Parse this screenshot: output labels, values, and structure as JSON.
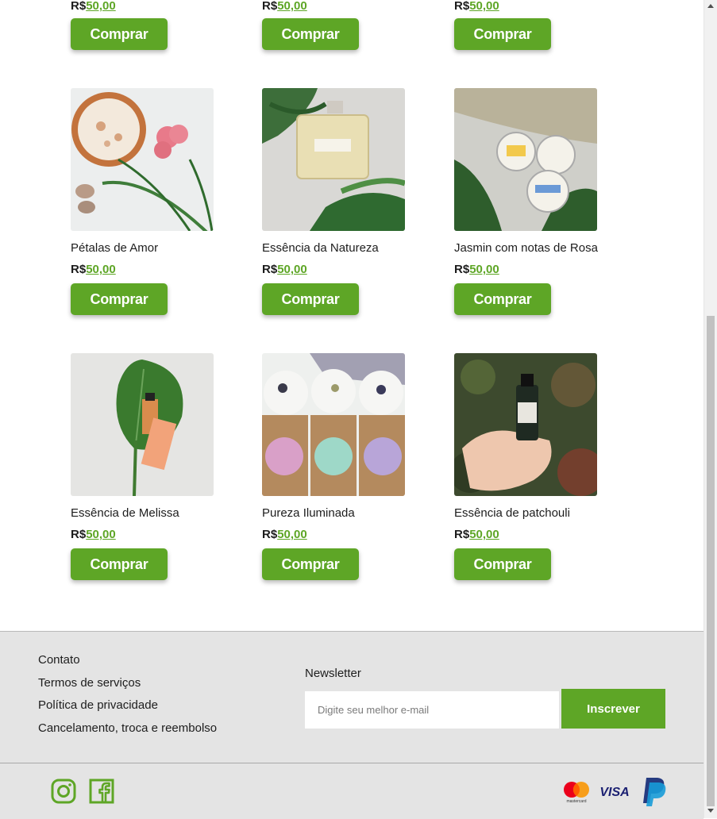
{
  "catalog": {
    "row0": [
      {
        "price_prefix": "R$",
        "price": "50,00",
        "buy_label": "Comprar"
      },
      {
        "price_prefix": "R$",
        "price": "50,00",
        "buy_label": "Comprar"
      },
      {
        "price_prefix": "R$",
        "price": "50,00",
        "buy_label": "Comprar"
      }
    ],
    "row1": [
      {
        "name": "Pétalas de Amor",
        "price_prefix": "R$",
        "price": "50,00",
        "buy_label": "Comprar"
      },
      {
        "name": "Essência da Natureza",
        "price_prefix": "R$",
        "price": "50,00",
        "buy_label": "Comprar"
      },
      {
        "name": "Jasmin com notas de Rosa",
        "price_prefix": "R$",
        "price": "50,00",
        "buy_label": "Comprar"
      }
    ],
    "row2": [
      {
        "name": "Essência de Melissa",
        "price_prefix": "R$",
        "price": "50,00",
        "buy_label": "Comprar"
      },
      {
        "name": "Pureza Iluminada",
        "price_prefix": "R$",
        "price": "50,00",
        "buy_label": "Comprar"
      },
      {
        "name": "Essência de patchouli",
        "price_prefix": "R$",
        "price": "50,00",
        "buy_label": "Comprar"
      }
    ]
  },
  "footer": {
    "links": [
      "Contato",
      "Termos de serviços",
      "Política de privacidade",
      "Cancelamento, troca e reembolso"
    ],
    "newsletter": {
      "title": "Newsletter",
      "placeholder": "Digite seu melhor e-mail",
      "button": "Inscrever"
    },
    "social_icons": [
      "instagram-icon",
      "facebook-icon"
    ],
    "payment_icons": [
      "mastercard-icon",
      "visa-icon",
      "paypal-icon"
    ],
    "payment": {
      "mastercard_label": "mastercard",
      "visa_label": "VISA"
    }
  },
  "colors": {
    "accent": "#5ea626",
    "footer_bg": "#e4e4e4",
    "text": "#1d1d1d"
  }
}
